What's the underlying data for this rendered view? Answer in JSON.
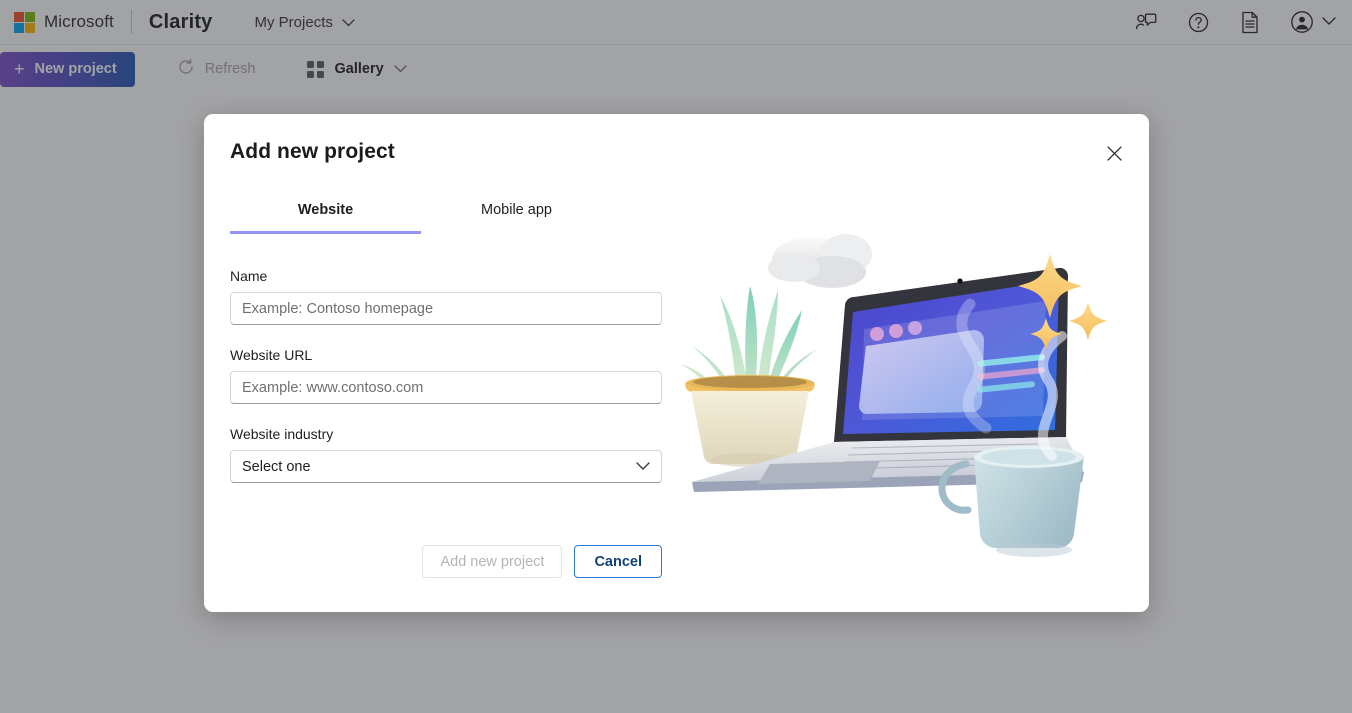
{
  "header": {
    "microsoft_label": "Microsoft",
    "brand": "Clarity",
    "nav_label": "My Projects",
    "icons": {
      "feedback": "feedback-icon",
      "help": "help-icon",
      "docs": "documentation-icon",
      "account": "account-icon",
      "chevron": "chevron-down-icon"
    }
  },
  "toolbar": {
    "new_project_label": "New project",
    "refresh_label": "Refresh",
    "gallery_label": "Gallery"
  },
  "dialog": {
    "title": "Add new project",
    "close_label": "✕",
    "tabs": [
      {
        "label": "Website",
        "active": true
      },
      {
        "label": "Mobile app",
        "active": false
      }
    ],
    "fields": {
      "name": {
        "label": "Name",
        "value": "",
        "placeholder": "Example: Contoso homepage"
      },
      "url": {
        "label": "Website URL",
        "value": "",
        "placeholder": "Example: www.contoso.com"
      },
      "industry": {
        "label": "Website industry",
        "value": "Select one"
      }
    },
    "buttons": {
      "submit_label": "Add new project",
      "submit_disabled": true,
      "cancel_label": "Cancel"
    },
    "illustration": "laptop-plant-coffee-illustration"
  },
  "colors": {
    "brand_gradient_start": "#7b4ec9",
    "brand_gradient_end": "#2255b5",
    "tab_underline": "#9494f4",
    "cancel_border": "#2a7bd4",
    "cancel_text": "#11417a",
    "disabled_text": "#b4b4b4",
    "scrim": "rgba(49,52,56,0.45)",
    "ms_red": "#f25022",
    "ms_green": "#7fba00",
    "ms_blue": "#00a4ef",
    "ms_yellow": "#ffb900"
  }
}
